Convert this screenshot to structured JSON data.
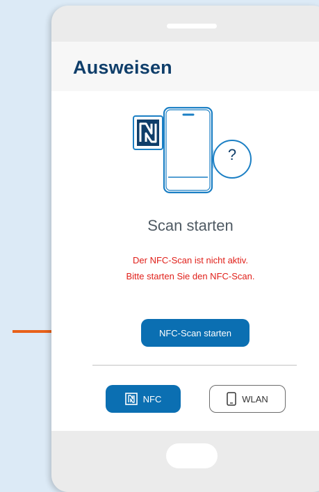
{
  "app": {
    "title": "Ausweisen"
  },
  "scan": {
    "heading": "Scan starten",
    "error_line1": "Der NFC-Scan ist nicht aktiv.",
    "error_line2": "Bitte starten Sie den NFC-Scan.",
    "start_button": "NFC-Scan starten"
  },
  "mode_toggle": {
    "nfc_label": "NFC",
    "wlan_label": "WLAN",
    "selected": "NFC"
  },
  "illustration": {
    "question_mark": "?"
  },
  "icons": {
    "nfc": "nfc-icon",
    "phone": "smartphone-icon",
    "pointer": "arrow-right-icon"
  },
  "colors": {
    "primary": "#0b6fb2",
    "title": "#0f3e6a",
    "error": "#e0201a",
    "arrow": "#e8611a"
  }
}
